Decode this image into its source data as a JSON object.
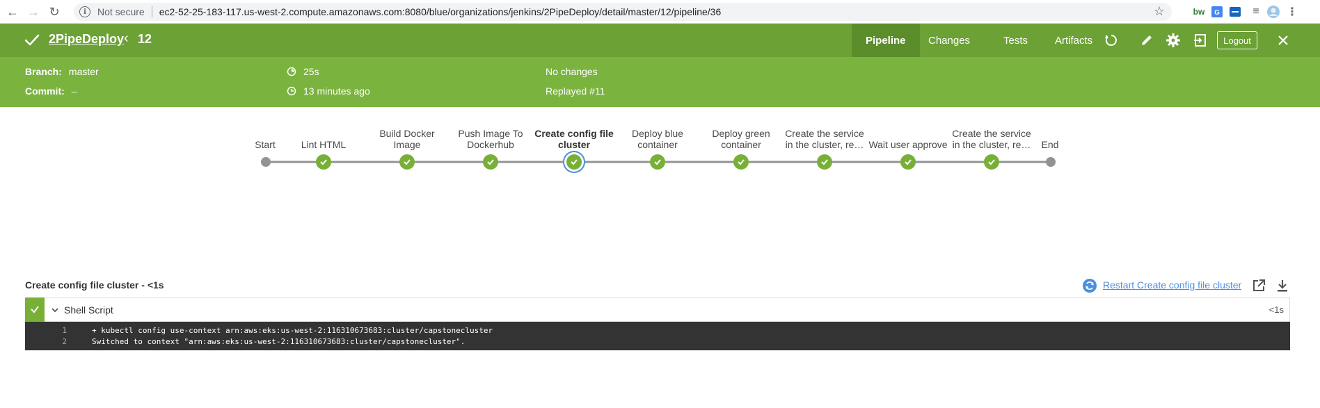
{
  "browser": {
    "security": "Not secure",
    "url": "ec2-52-25-183-117.us-west-2.compute.amazonaws.com:8080/blue/organizations/jenkins/2PipeDeploy/detail/master/12/pipeline/36"
  },
  "header": {
    "pipeline_name": "2PipeDeploy",
    "run_number": "12",
    "tabs": [
      {
        "label": "Pipeline",
        "active": true
      },
      {
        "label": "Changes",
        "active": false
      },
      {
        "label": "Tests",
        "active": false
      },
      {
        "label": "Artifacts",
        "active": false
      }
    ],
    "logout_label": "Logout"
  },
  "summary": {
    "branch_label": "Branch:",
    "branch_value": "master",
    "commit_label": "Commit:",
    "commit_value": "–",
    "duration": "25s",
    "started": "13 minutes ago",
    "changes": "No changes",
    "replayed": "Replayed #11"
  },
  "stages": [
    {
      "label": "Start",
      "type": "start"
    },
    {
      "label": "Lint HTML",
      "type": "success"
    },
    {
      "label": "Build Docker Image",
      "type": "success"
    },
    {
      "label": "Push Image To Dockerhub",
      "type": "success"
    },
    {
      "label": "Create config file cluster",
      "type": "success",
      "selected": true
    },
    {
      "label": "Deploy blue container",
      "type": "success"
    },
    {
      "label": "Deploy green container",
      "type": "success"
    },
    {
      "label": "Create the service in the cluster, re…",
      "type": "success"
    },
    {
      "label": "Wait user approve",
      "type": "success"
    },
    {
      "label": "Create the service in the cluster, re…",
      "type": "success"
    },
    {
      "label": "End",
      "type": "end"
    }
  ],
  "step": {
    "title": "Create config file cluster - <1s",
    "restart_label": "Restart Create config file cluster",
    "name": "Shell Script",
    "duration": "<1s",
    "log": [
      {
        "num": "1",
        "text": "+ kubectl config use-context arn:aws:eks:us-west-2:116310673683:cluster/capstonecluster"
      },
      {
        "num": "2",
        "text": "Switched to context \"arn:aws:eks:us-west-2:116310673683:cluster/capstonecluster\"."
      }
    ]
  },
  "colors": {
    "header_green": "#6ca136",
    "summary_green": "#7bb33f",
    "success_green": "#78b037",
    "selected_ring": "#4a90e2",
    "log_bg": "#333333"
  }
}
